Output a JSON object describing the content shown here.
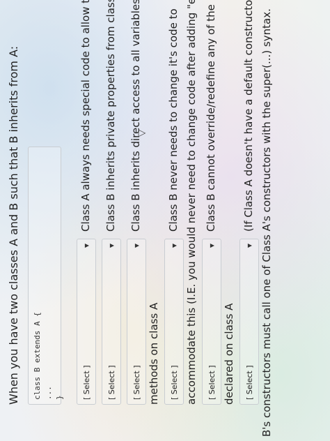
{
  "question": "When you have two classes A and B such that B inherits from A:",
  "code": {
    "line1": "class B extends A {",
    "line2": "...",
    "line3": "}"
  },
  "select_label": "[ Select ]",
  "options": [
    {
      "text": "Class A always needs special code to allow this"
    },
    {
      "text": "Class B inherits private properties from class A"
    },
    {
      "text": "Class B inherits direct access to all variables and",
      "line2": "methods on class A"
    },
    {
      "text": "Class B never needs to change it's code to",
      "line2": "accommodate this (I.E. you would never need to change code after adding \"extends A\""
    },
    {
      "text": "Class B cannot override/redefine any of the methods",
      "line2": "declared on class A"
    },
    {
      "text": "(If Class A doesn't have a default constructor) Class",
      "line2": "B's constructors must call one of Class A's constructors with the super(...) syntax."
    }
  ]
}
